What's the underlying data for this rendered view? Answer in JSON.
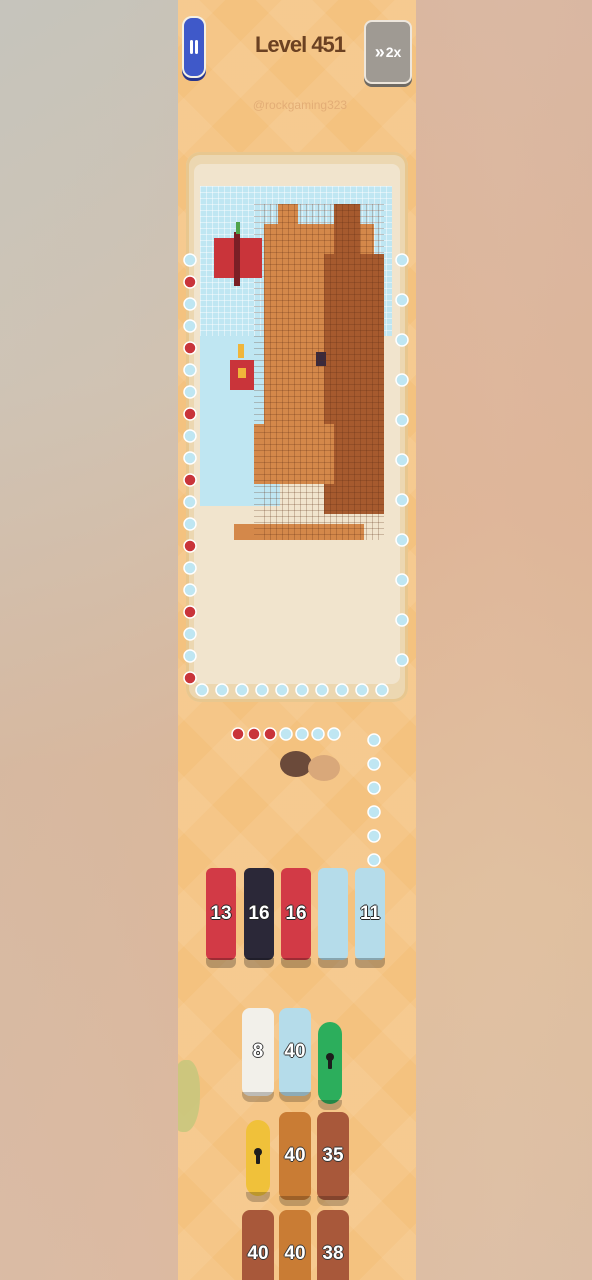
{
  "header": {
    "level_label": "Level 451",
    "watermark": "@rockgaming323",
    "speed_label": "2x"
  },
  "colors": {
    "background": "#f4c27f",
    "sky": "#bfe6f2",
    "paper": "#f1e4cd",
    "rabbit_light": "#d4884a",
    "rabbit_dark": "#a65a2e",
    "butterfly": "#c9343a",
    "red_slot": "#d23a46",
    "navy_slot": "#2b2838",
    "ice_slot": "#b5dcea",
    "white_tile": "#f2f0ea",
    "brown_tile": "#a8583a",
    "orange_tile": "#c97c34",
    "green_lock": "#2cae5c",
    "yellow_lock": "#f0c13a"
  },
  "slots": [
    {
      "count": "13",
      "color": "#d23a46"
    },
    {
      "count": "16",
      "color": "#2b2838"
    },
    {
      "count": "16",
      "color": "#d23a46"
    },
    {
      "count": "",
      "color": "#b5dcea"
    },
    {
      "count": "11",
      "color": "#b5dcea"
    }
  ],
  "trays": [
    {
      "count": "8",
      "color": "#f2f0ea"
    },
    {
      "count": "40",
      "color": "#b5dcea"
    },
    {
      "count": "",
      "color": "#2cae5c",
      "locked": true
    },
    {
      "count": "",
      "color": "#f0c13a",
      "locked": true
    },
    {
      "count": "40",
      "color": "#c97c34"
    },
    {
      "count": "35",
      "color": "#a8583a"
    },
    {
      "count": "40",
      "color": "#a8583a"
    },
    {
      "count": "40",
      "color": "#c97c34"
    },
    {
      "count": "38",
      "color": "#a8583a"
    }
  ]
}
